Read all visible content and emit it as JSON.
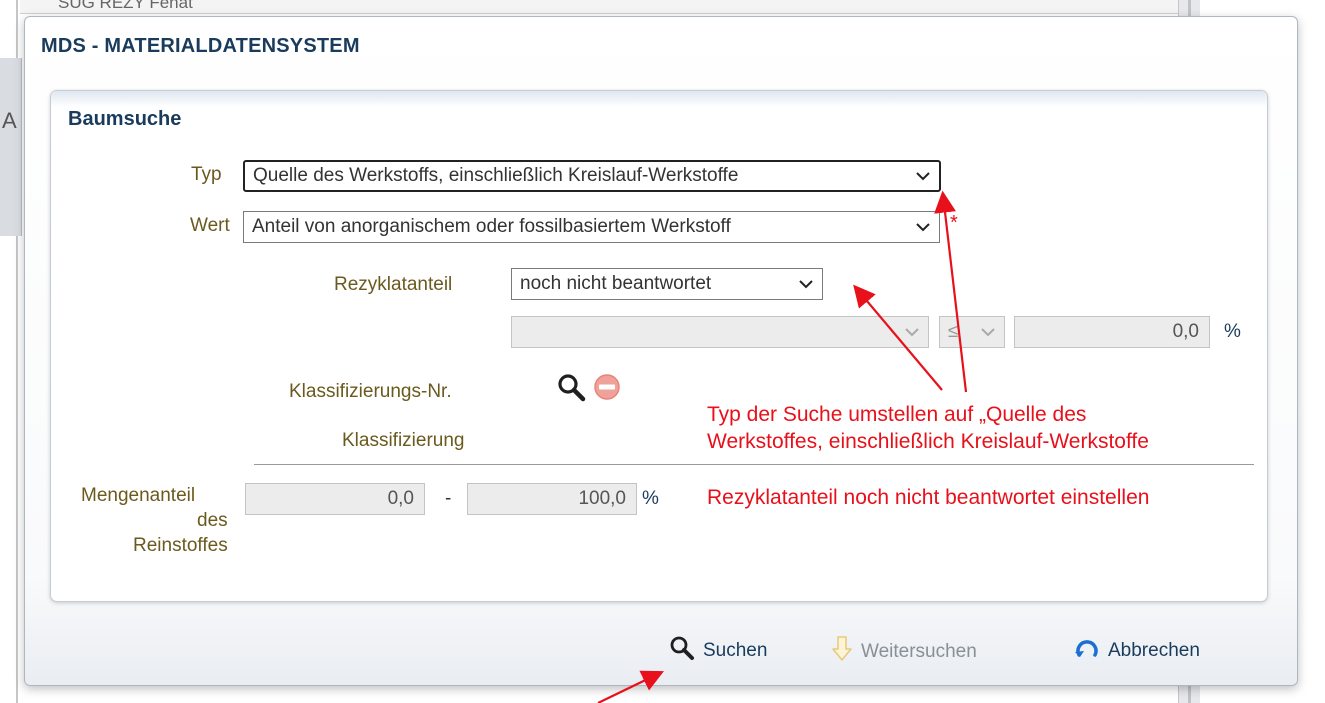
{
  "background": {
    "top_fragment": "SUG REZY Fenat",
    "left_fragment": "A"
  },
  "dialog": {
    "title": "MDS - MATERIALDATENSYSTEM"
  },
  "panel": {
    "title": "Baumsuche"
  },
  "form": {
    "typ": {
      "label": "Typ",
      "value": "Quelle des Werkstoffs, einschließlich Kreislauf-Werkstoffe"
    },
    "wert": {
      "label": "Wert",
      "value": "Anteil von anorganischem oder fossilbasiertem Werkstoff",
      "required_marker": "*"
    },
    "rezyklatanteil": {
      "label": "Rezyklatanteil",
      "value": "noch nicht beantwortet"
    },
    "range": {
      "operator": "≤",
      "value": "0,0",
      "unit": "%"
    },
    "klassifizierungs_nr": {
      "label": "Klassifizierungs-Nr."
    },
    "klassifizierung": {
      "label": "Klassifizierung"
    },
    "mengenanteil": {
      "label_1": "Mengenanteil",
      "label_2": "des",
      "label_3": "Reinstoffes",
      "from": "0,0",
      "dash": "-",
      "to": "100,0",
      "unit": "%"
    }
  },
  "footer": {
    "search_label": "Suchen",
    "continue_label": "Weitersuchen",
    "cancel_label": "Abbrechen"
  },
  "annotations": {
    "line1": "Typ der Suche umstellen auf „Quelle des",
    "line2": "Werkstoffes, einschließlich Kreislauf-Werkstoffe",
    "line3": "Rezyklatanteil noch nicht beantwortet einstellen",
    "color": "#e8101a"
  },
  "icons": [
    "search-icon",
    "remove-icon",
    "arrow-down-icon",
    "refresh-icon",
    "chevron-down-icon"
  ]
}
